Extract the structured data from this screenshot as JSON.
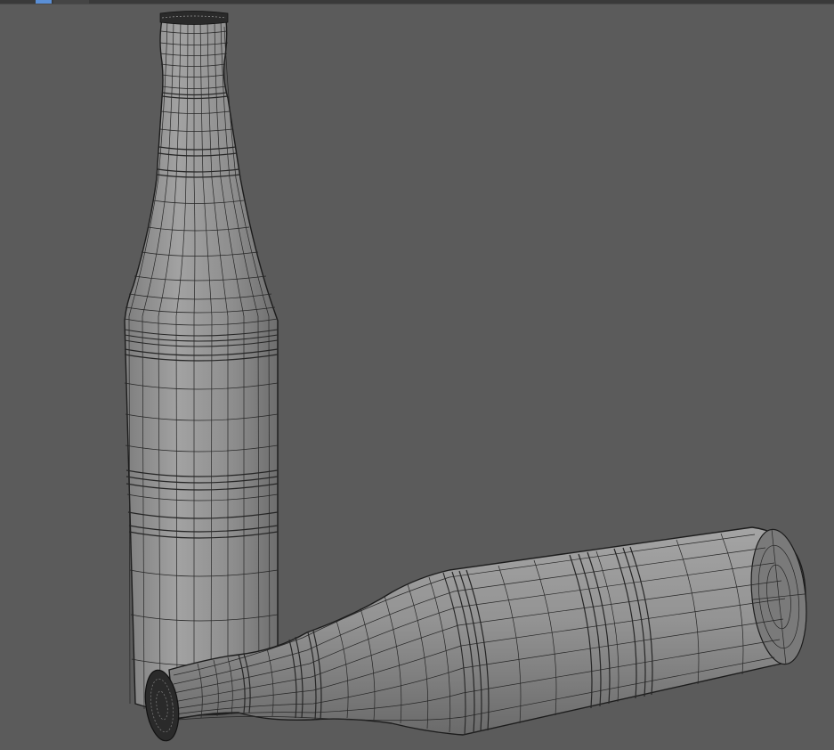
{
  "viewport": {
    "background": "#5b5b5b",
    "shading": "#8e8e8e",
    "wire_color": "#1c1c1c",
    "display_mode": "wireframe-on-shaded"
  },
  "objects": [
    {
      "name": "standing-bottle",
      "kind": "bottle",
      "orientation": "upright"
    },
    {
      "name": "lying-bottle",
      "kind": "bottle",
      "orientation": "on side"
    }
  ],
  "toolbar": {
    "active_tab_color": "#5a8fd6"
  }
}
